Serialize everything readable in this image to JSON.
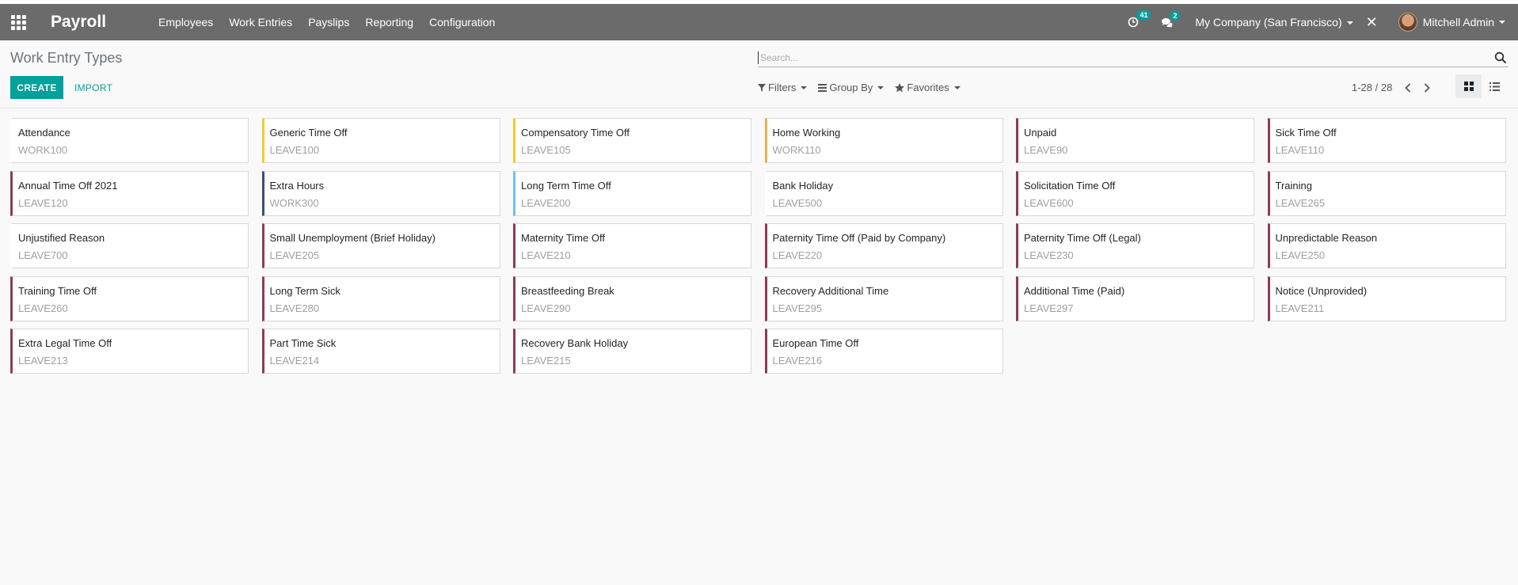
{
  "navbar": {
    "app_title": "Payroll",
    "menu": [
      "Employees",
      "Work Entries",
      "Payslips",
      "Reporting",
      "Configuration"
    ],
    "activity_count": "41",
    "message_count": "2",
    "company": "My Company (San Francisco)",
    "user": "Mitchell Admin",
    "bg_color": "#6b6b6b"
  },
  "control": {
    "breadcrumb": "Work Entry Types",
    "create_label": "CREATE",
    "import_label": "IMPORT",
    "search_placeholder": "Search...",
    "filters_label": "Filters",
    "groupby_label": "Group By",
    "favorites_label": "Favorites",
    "pager": "1-28 / 28",
    "accent": "#00a09d"
  },
  "cards": [
    {
      "name": "Attendance",
      "code": "WORK100",
      "color": "transparent"
    },
    {
      "name": "Generic Time Off",
      "code": "LEAVE100",
      "color": "#f4cc2b"
    },
    {
      "name": "Compensatory Time Off",
      "code": "LEAVE105",
      "color": "#f4cc2b"
    },
    {
      "name": "Home Working",
      "code": "WORK110",
      "color": "#f0ad4e"
    },
    {
      "name": "Unpaid",
      "code": "LEAVE90",
      "color": "#8e3a59"
    },
    {
      "name": "Sick Time Off",
      "code": "LEAVE110",
      "color": "#8e3a59"
    },
    {
      "name": "Annual Time Off 2021",
      "code": "LEAVE120",
      "color": "#8e3a59"
    },
    {
      "name": "Extra Hours",
      "code": "WORK300",
      "color": "#3d4f73"
    },
    {
      "name": "Long Term Time Off",
      "code": "LEAVE200",
      "color": "#6cc1ed"
    },
    {
      "name": "Bank Holiday",
      "code": "LEAVE500",
      "color": "transparent"
    },
    {
      "name": "Solicitation Time Off",
      "code": "LEAVE600",
      "color": "#8e3a59"
    },
    {
      "name": "Training",
      "code": "LEAVE265",
      "color": "#8e3a59"
    },
    {
      "name": "Unjustified Reason",
      "code": "LEAVE700",
      "color": "transparent"
    },
    {
      "name": "Small Unemployment (Brief Holiday)",
      "code": "LEAVE205",
      "color": "#8e3a59"
    },
    {
      "name": "Maternity Time Off",
      "code": "LEAVE210",
      "color": "#8e3a59"
    },
    {
      "name": "Paternity Time Off (Paid by Company)",
      "code": "LEAVE220",
      "color": "#8e3a59"
    },
    {
      "name": "Paternity Time Off (Legal)",
      "code": "LEAVE230",
      "color": "#8e3a59"
    },
    {
      "name": "Unpredictable Reason",
      "code": "LEAVE250",
      "color": "#8e3a59"
    },
    {
      "name": "Training Time Off",
      "code": "LEAVE260",
      "color": "#8e3a59"
    },
    {
      "name": "Long Term Sick",
      "code": "LEAVE280",
      "color": "#8e3a59"
    },
    {
      "name": "Breastfeeding Break",
      "code": "LEAVE290",
      "color": "#8e3a59"
    },
    {
      "name": "Recovery Additional Time",
      "code": "LEAVE295",
      "color": "#8e3a59"
    },
    {
      "name": "Additional Time (Paid)",
      "code": "LEAVE297",
      "color": "#8e3a59"
    },
    {
      "name": "Notice (Unprovided)",
      "code": "LEAVE211",
      "color": "#8e3a59"
    },
    {
      "name": "Extra Legal Time Off",
      "code": "LEAVE213",
      "color": "#8e3a59"
    },
    {
      "name": "Part Time Sick",
      "code": "LEAVE214",
      "color": "#8e3a59"
    },
    {
      "name": "Recovery Bank Holiday",
      "code": "LEAVE215",
      "color": "#8e3a59"
    },
    {
      "name": "European Time Off",
      "code": "LEAVE216",
      "color": "#8e3a59"
    }
  ]
}
